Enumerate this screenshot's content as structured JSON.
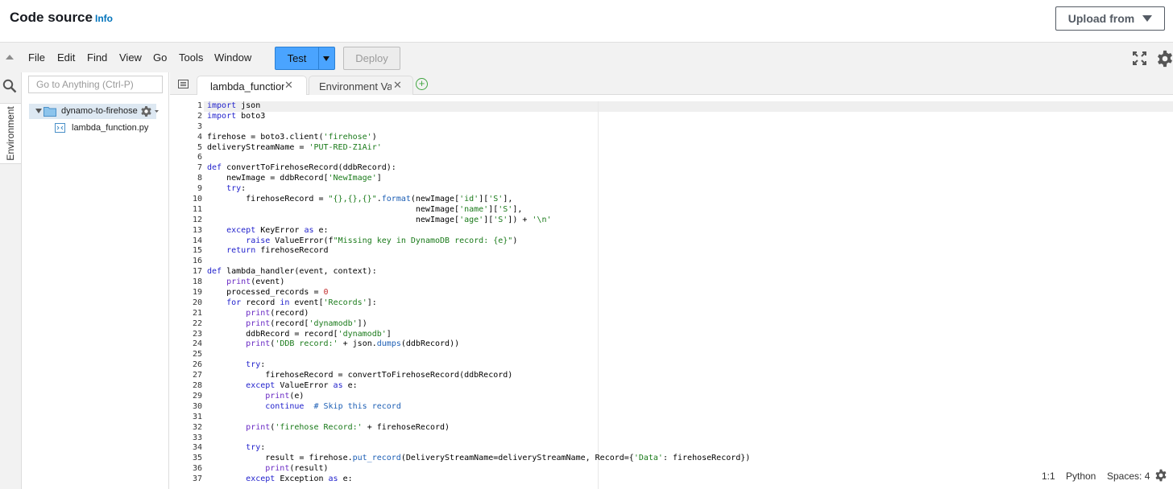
{
  "header": {
    "title": "Code source",
    "info_label": "Info",
    "upload_label": "Upload from"
  },
  "menu": {
    "items": [
      "File",
      "Edit",
      "Find",
      "View",
      "Go",
      "Tools",
      "Window"
    ],
    "test_label": "Test",
    "deploy_label": "Deploy"
  },
  "sidebar": {
    "environment_label": "Environment",
    "search_placeholder": "Go to Anything (Ctrl-P)",
    "folder_name": "dynamo-to-firehose",
    "file_name": "lambda_function.py"
  },
  "tabs": [
    {
      "label": "lambda_function",
      "active": true
    },
    {
      "label": "Environment Vari",
      "active": false
    }
  ],
  "editor": {
    "line_numbers": [
      "1",
      "2",
      "3",
      "4",
      "5",
      "6",
      "7",
      "8",
      "9",
      "10",
      "11",
      "12",
      "13",
      "14",
      "15",
      "16",
      "17",
      "18",
      "19",
      "20",
      "21",
      "22",
      "23",
      "24",
      "25",
      "26",
      "27",
      "28",
      "29",
      "30",
      "31",
      "32",
      "33",
      "34",
      "35",
      "36",
      "37"
    ],
    "lines": [
      "import json",
      "import boto3",
      "",
      "firehose = boto3.client('firehose')",
      "deliveryStreamName = 'PUT-RED-Z1Air'",
      "",
      "def convertToFirehoseRecord(ddbRecord):",
      "    newImage = ddbRecord['NewImage']",
      "    try:",
      "        firehoseRecord = \"{},{},{}\".format(newImage['id']['S'],",
      "                                           newImage['name']['S'],",
      "                                           newImage['age']['S']) + '\\n'",
      "    except KeyError as e:",
      "        raise ValueError(f\"Missing key in DynamoDB record: {e}\")",
      "    return firehoseRecord",
      "",
      "def lambda_handler(event, context):",
      "    print(event)",
      "    processed_records = 0",
      "    for record in event['Records']:",
      "        print(record)",
      "        print(record['dynamodb'])",
      "        ddbRecord = record['dynamodb']",
      "        print('DDB record:' + json.dumps(ddbRecord))",
      "",
      "        try:",
      "            firehoseRecord = convertToFirehoseRecord(ddbRecord)",
      "        except ValueError as e:",
      "            print(e)",
      "            continue  # Skip this record",
      "",
      "        print('firehose Record:' + firehoseRecord)",
      "",
      "        try:",
      "            result = firehose.put_record(DeliveryStreamName=deliveryStreamName, Record={'Data': firehoseRecord})",
      "            print(result)",
      "        except Exception as e:"
    ]
  },
  "status": {
    "position": "1:1",
    "language": "Python",
    "spaces": "Spaces: 4"
  },
  "colors": {
    "test_button": "#4aa4ff",
    "info_link": "#0073bb",
    "keyword": "#2222cc",
    "builtin": "#6a2bc4",
    "string": "#1a7a1a"
  }
}
